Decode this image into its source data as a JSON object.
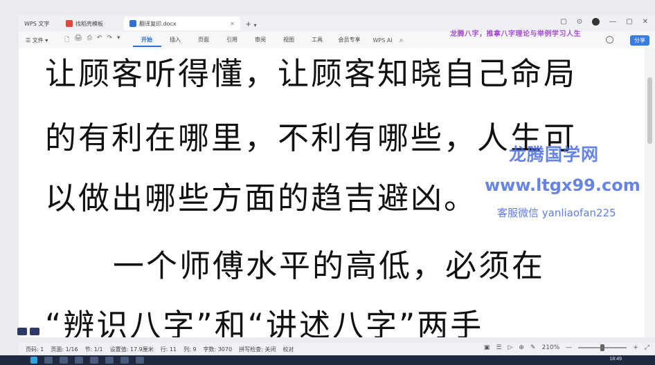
{
  "titlebar": {
    "app_tab": "WPS 文字",
    "tab2": "找稻壳模板",
    "tab3": "翻译复印.docx",
    "new_tab": "+",
    "new_tab_caret": "▾",
    "win_controls": [
      "▢",
      "⊙",
      "—",
      "▢",
      "✕"
    ]
  },
  "ribbon": {
    "file_menu": "☰ 文件 ▾",
    "quick_icons": [
      "🗋",
      "🖨",
      "⎙",
      "↶",
      "↷",
      "▾"
    ],
    "menus": [
      "开始",
      "插入",
      "页面",
      "引用",
      "审阅",
      "视图",
      "工具",
      "会员专享"
    ],
    "active_menu": 0,
    "wps_ai": "WPS AI",
    "search_icon": "⌕",
    "share": "分享"
  },
  "promo_text": "龙腾八字，推拿八字理论与举例学习人生",
  "document": {
    "lines": [
      "让顾客听得懂，让顾客知晓自己命局",
      "的有利在哪里，不利有哪些，人生可",
      "以做出哪些方面的趋吉避凶。",
      "一个师傅水平的高低，必须在",
      "“辨识八字”和“讲述八字”两手"
    ]
  },
  "watermark": {
    "name": "龙腾国学网",
    "url": "www.ltgx99.com",
    "contact": "客服微信 yanliaofan225"
  },
  "statusbar": {
    "page": "页码: 1",
    "pages": "页面: 1/16",
    "section": "节: 1/1",
    "position": "设置值: 17.9厘米",
    "row": "行: 11",
    "col": "列: 9",
    "wordcount": "字数: 3070",
    "spellcheck": "拼写检查: 关闭",
    "proof": "校对",
    "zoom": "210%",
    "zoom_minus": "—",
    "zoom_plus": "+",
    "fullscreen": "⤢"
  },
  "taskbar": {
    "clock": "18:49"
  }
}
